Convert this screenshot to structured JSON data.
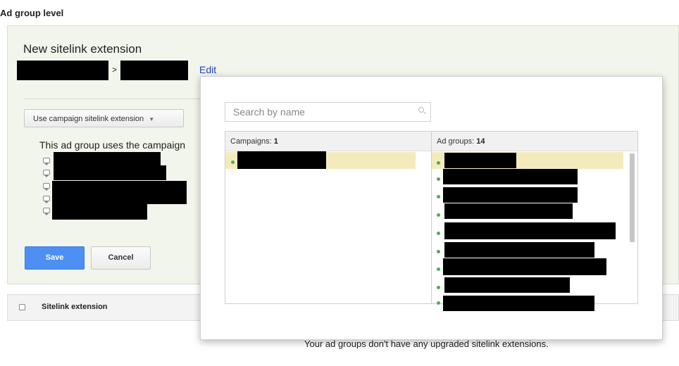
{
  "page": {
    "heading": "Ad group level"
  },
  "editor": {
    "title": "New sitelink extension",
    "breadcrumb_separator": ">",
    "edit_link": "Edit",
    "dropdown_label": "Use campaign sitelink extension",
    "info_text": "This ad group uses the campaign",
    "save_label": "Save",
    "cancel_label": "Cancel"
  },
  "table": {
    "column_label": "Sitelink extension",
    "empty_message": "Your ad groups don't have any upgraded sitelink extensions."
  },
  "popup": {
    "search_placeholder": "Search by name",
    "campaigns_label": "Campaigns:",
    "campaigns_count": "1",
    "adgroups_label": "Ad groups:",
    "adgroups_count": "14"
  },
  "colors": {
    "panel_bg": "#f2f5ec",
    "primary_button": "#4d8ff3",
    "link": "#2244bb",
    "highlight_row": "#f3ebbd",
    "status_dot": "#4caf50"
  },
  "icons": {
    "dropdown": "chevron-down-icon",
    "search": "search-icon",
    "sitelink": "speech-bubble-icon",
    "status": "green-dot-icon"
  }
}
